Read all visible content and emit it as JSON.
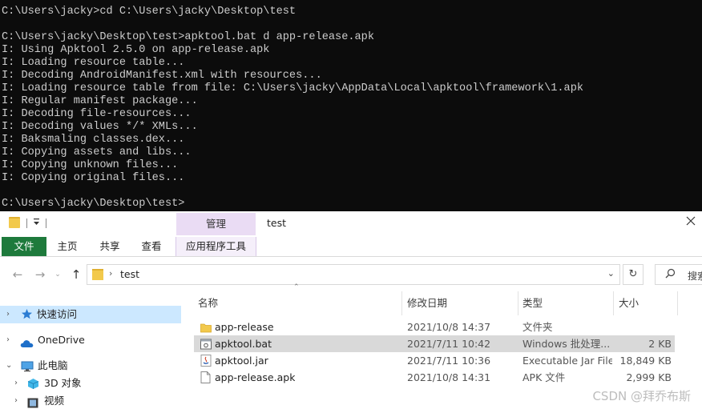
{
  "terminal": {
    "lines": [
      "C:\\Users\\jacky>cd C:\\Users\\jacky\\Desktop\\test",
      "",
      "C:\\Users\\jacky\\Desktop\\test>apktool.bat d app-release.apk",
      "I: Using Apktool 2.5.0 on app-release.apk",
      "I: Loading resource table...",
      "I: Decoding AndroidManifest.xml with resources...",
      "I: Loading resource table from file: C:\\Users\\jacky\\AppData\\Local\\apktool\\framework\\1.apk",
      "I: Regular manifest package...",
      "I: Decoding file-resources...",
      "I: Decoding values */* XMLs...",
      "I: Baksmaling classes.dex...",
      "I: Copying assets and libs...",
      "I: Copying unknown files...",
      "I: Copying original files...",
      "",
      "C:\\Users\\jacky\\Desktop\\test>"
    ]
  },
  "explorer": {
    "context_tab_group": "管理",
    "window_title": "test",
    "ribbon_tabs": {
      "file": "文件",
      "home": "主页",
      "share": "共享",
      "view": "查看",
      "app_tools": "应用程序工具"
    },
    "address": {
      "path": "test",
      "search_placeholder": "搜索"
    },
    "nav_pane": {
      "quick_access": "快速访问",
      "onedrive": "OneDrive",
      "this_pc": "此电脑",
      "objects_3d": "3D 对象",
      "videos": "视频"
    },
    "columns": {
      "name": "名称",
      "date": "修改日期",
      "type": "类型",
      "size": "大小"
    },
    "files": [
      {
        "name": "app-release",
        "date": "2021/10/8 14:37",
        "type": "文件夹",
        "size": ""
      },
      {
        "name": "apktool.bat",
        "date": "2021/7/11 10:42",
        "type": "Windows 批处理...",
        "size": "2 KB"
      },
      {
        "name": "apktool.jar",
        "date": "2021/7/11 10:36",
        "type": "Executable Jar File",
        "size": "18,849 KB"
      },
      {
        "name": "app-release.apk",
        "date": "2021/10/8 14:31",
        "type": "APK 文件",
        "size": "2,999 KB"
      }
    ],
    "watermark": "CSDN @拜乔布斯"
  },
  "colors": {
    "terminal_bg": "#0c0c0c",
    "terminal_text": "#cccccc",
    "file_tab": "#1e7a3c",
    "context_tab": "#eadcf4",
    "nav_selected": "#cce8ff",
    "row_selected": "#d9d9d9"
  }
}
